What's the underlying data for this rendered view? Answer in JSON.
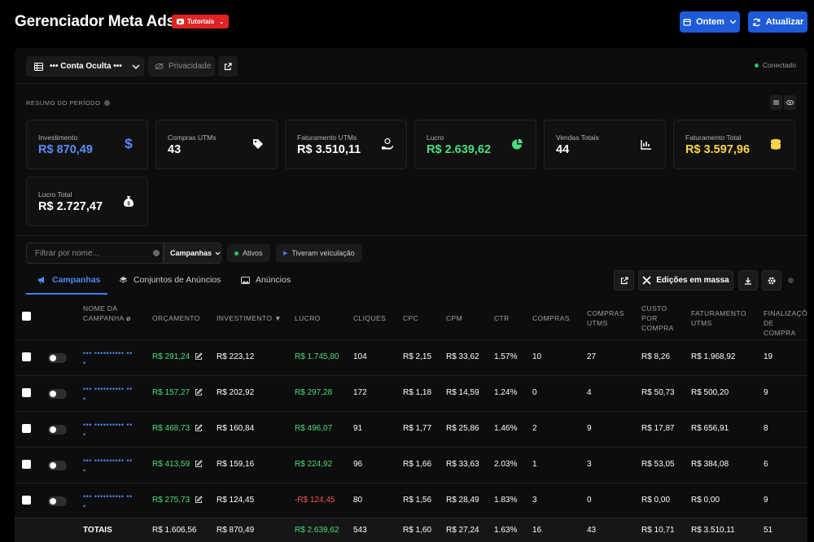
{
  "header": {
    "title": "Gerenciador Meta Ads",
    "tutorials_label": "Tutoriais",
    "date_button": "Ontem",
    "refresh_button": "Atualizar"
  },
  "topbar": {
    "account": "••• Conta Oculta •••",
    "privacy": "Privacidade",
    "status": "Conectado"
  },
  "summary": {
    "label": "RESUMO DO PERÍODO",
    "cards": [
      {
        "label": "Investimento",
        "value": "R$ 870,49",
        "color": "#5b8cf7",
        "icon": "dollar-icon"
      },
      {
        "label": "Compras UTMs",
        "value": "43",
        "color": "#ffffff",
        "icon": "tag-icon"
      },
      {
        "label": "Faturamento UTMs",
        "value": "R$ 3.510,11",
        "color": "#ffffff",
        "icon": "hand-coin-icon"
      },
      {
        "label": "Lucro",
        "value": "R$ 2.639,62",
        "color": "#4ade80",
        "icon": "pie-chart-icon"
      },
      {
        "label": "Vendas Totais",
        "value": "44",
        "color": "#ffffff",
        "icon": "bar-chart-icon"
      },
      {
        "label": "Faturamento Total",
        "value": "R$ 3.597,96",
        "color": "#fcd34d",
        "icon": "coins-icon"
      },
      {
        "label": "Lucro Total",
        "value": "R$ 2.727,47",
        "color": "#ffffff",
        "icon": "money-bag-icon"
      }
    ]
  },
  "filters": {
    "search_placeholder": "Filtrar por nome...",
    "level_select": "Campanhas",
    "chip_active": "Ativos",
    "chip_delivered": "Tiveram veiculação"
  },
  "tabs": [
    {
      "label": "Campanhas"
    },
    {
      "label": "Conjuntos de Anúncios"
    },
    {
      "label": "Anúncios"
    }
  ],
  "toolbar": {
    "bulk_edit": "Edições em massa"
  },
  "table": {
    "columns": [
      "NOME DA CAMPANHA",
      "ORÇAMENTO",
      "INVESTIMENTO ▼",
      "LUCRO",
      "CLIQUES",
      "CPC",
      "CPM",
      "CTR",
      "COMPRAS",
      "COMPRAS UTMS",
      "CUSTO POR COMPRA",
      "FATURAMENTO UTMS",
      "FINALIZAÇÕ DE COMPRA"
    ],
    "rows": [
      {
        "name": "••• •••••••••• •••",
        "budget": "R$ 291,24",
        "invest": "R$ 223,12",
        "profit": "R$ 1.745,80",
        "profit_neg": false,
        "clicks": "104",
        "cpc": "R$ 2,15",
        "cpm": "R$ 33,62",
        "ctr": "1.57%",
        "purchases": "10",
        "purchases_utm": "27",
        "cost_per": "R$ 8,26",
        "revenue_utm": "R$ 1.968,92",
        "checkout": "19"
      },
      {
        "name": "••• •••••••••• •••",
        "budget": "R$ 157,27",
        "invest": "R$ 202,92",
        "profit": "R$ 297,28",
        "profit_neg": false,
        "clicks": "172",
        "cpc": "R$ 1,18",
        "cpm": "R$ 14,59",
        "ctr": "1.24%",
        "purchases": "0",
        "purchases_utm": "4",
        "cost_per": "R$ 50,73",
        "revenue_utm": "R$ 500,20",
        "checkout": "9"
      },
      {
        "name": "••• •••••••••• •••",
        "budget": "R$ 468,73",
        "invest": "R$ 160,84",
        "profit": "R$ 496,07",
        "profit_neg": false,
        "clicks": "91",
        "cpc": "R$ 1,77",
        "cpm": "R$ 25,86",
        "ctr": "1.46%",
        "purchases": "2",
        "purchases_utm": "9",
        "cost_per": "R$ 17,87",
        "revenue_utm": "R$ 656,91",
        "checkout": "8"
      },
      {
        "name": "••• •••••••••• •••",
        "budget": "R$ 413,59",
        "invest": "R$ 159,16",
        "profit": "R$ 224,92",
        "profit_neg": false,
        "clicks": "96",
        "cpc": "R$ 1,66",
        "cpm": "R$ 33,63",
        "ctr": "2.03%",
        "purchases": "1",
        "purchases_utm": "3",
        "cost_per": "R$ 53,05",
        "revenue_utm": "R$ 384,08",
        "checkout": "6"
      },
      {
        "name": "••• •••••••••• •••",
        "budget": "R$ 275,73",
        "invest": "R$ 124,45",
        "profit": "-R$ 124,45",
        "profit_neg": true,
        "clicks": "80",
        "cpc": "R$ 1,56",
        "cpm": "R$ 28,49",
        "ctr": "1.83%",
        "purchases": "3",
        "purchases_utm": "0",
        "cost_per": "R$ 0,00",
        "revenue_utm": "R$ 0,00",
        "checkout": "9"
      }
    ],
    "totals": {
      "label": "TOTAIS",
      "budget": "R$ 1.606,56",
      "invest": "R$ 870,49",
      "profit": "R$ 2.639,62",
      "clicks": "543",
      "cpc": "R$ 1,60",
      "cpm": "R$ 27,24",
      "ctr": "1.63%",
      "purchases": "16",
      "purchases_utm": "43",
      "cost_per": "R$ 10,71",
      "revenue_utm": "R$ 3.510,11",
      "checkout": "51"
    }
  }
}
